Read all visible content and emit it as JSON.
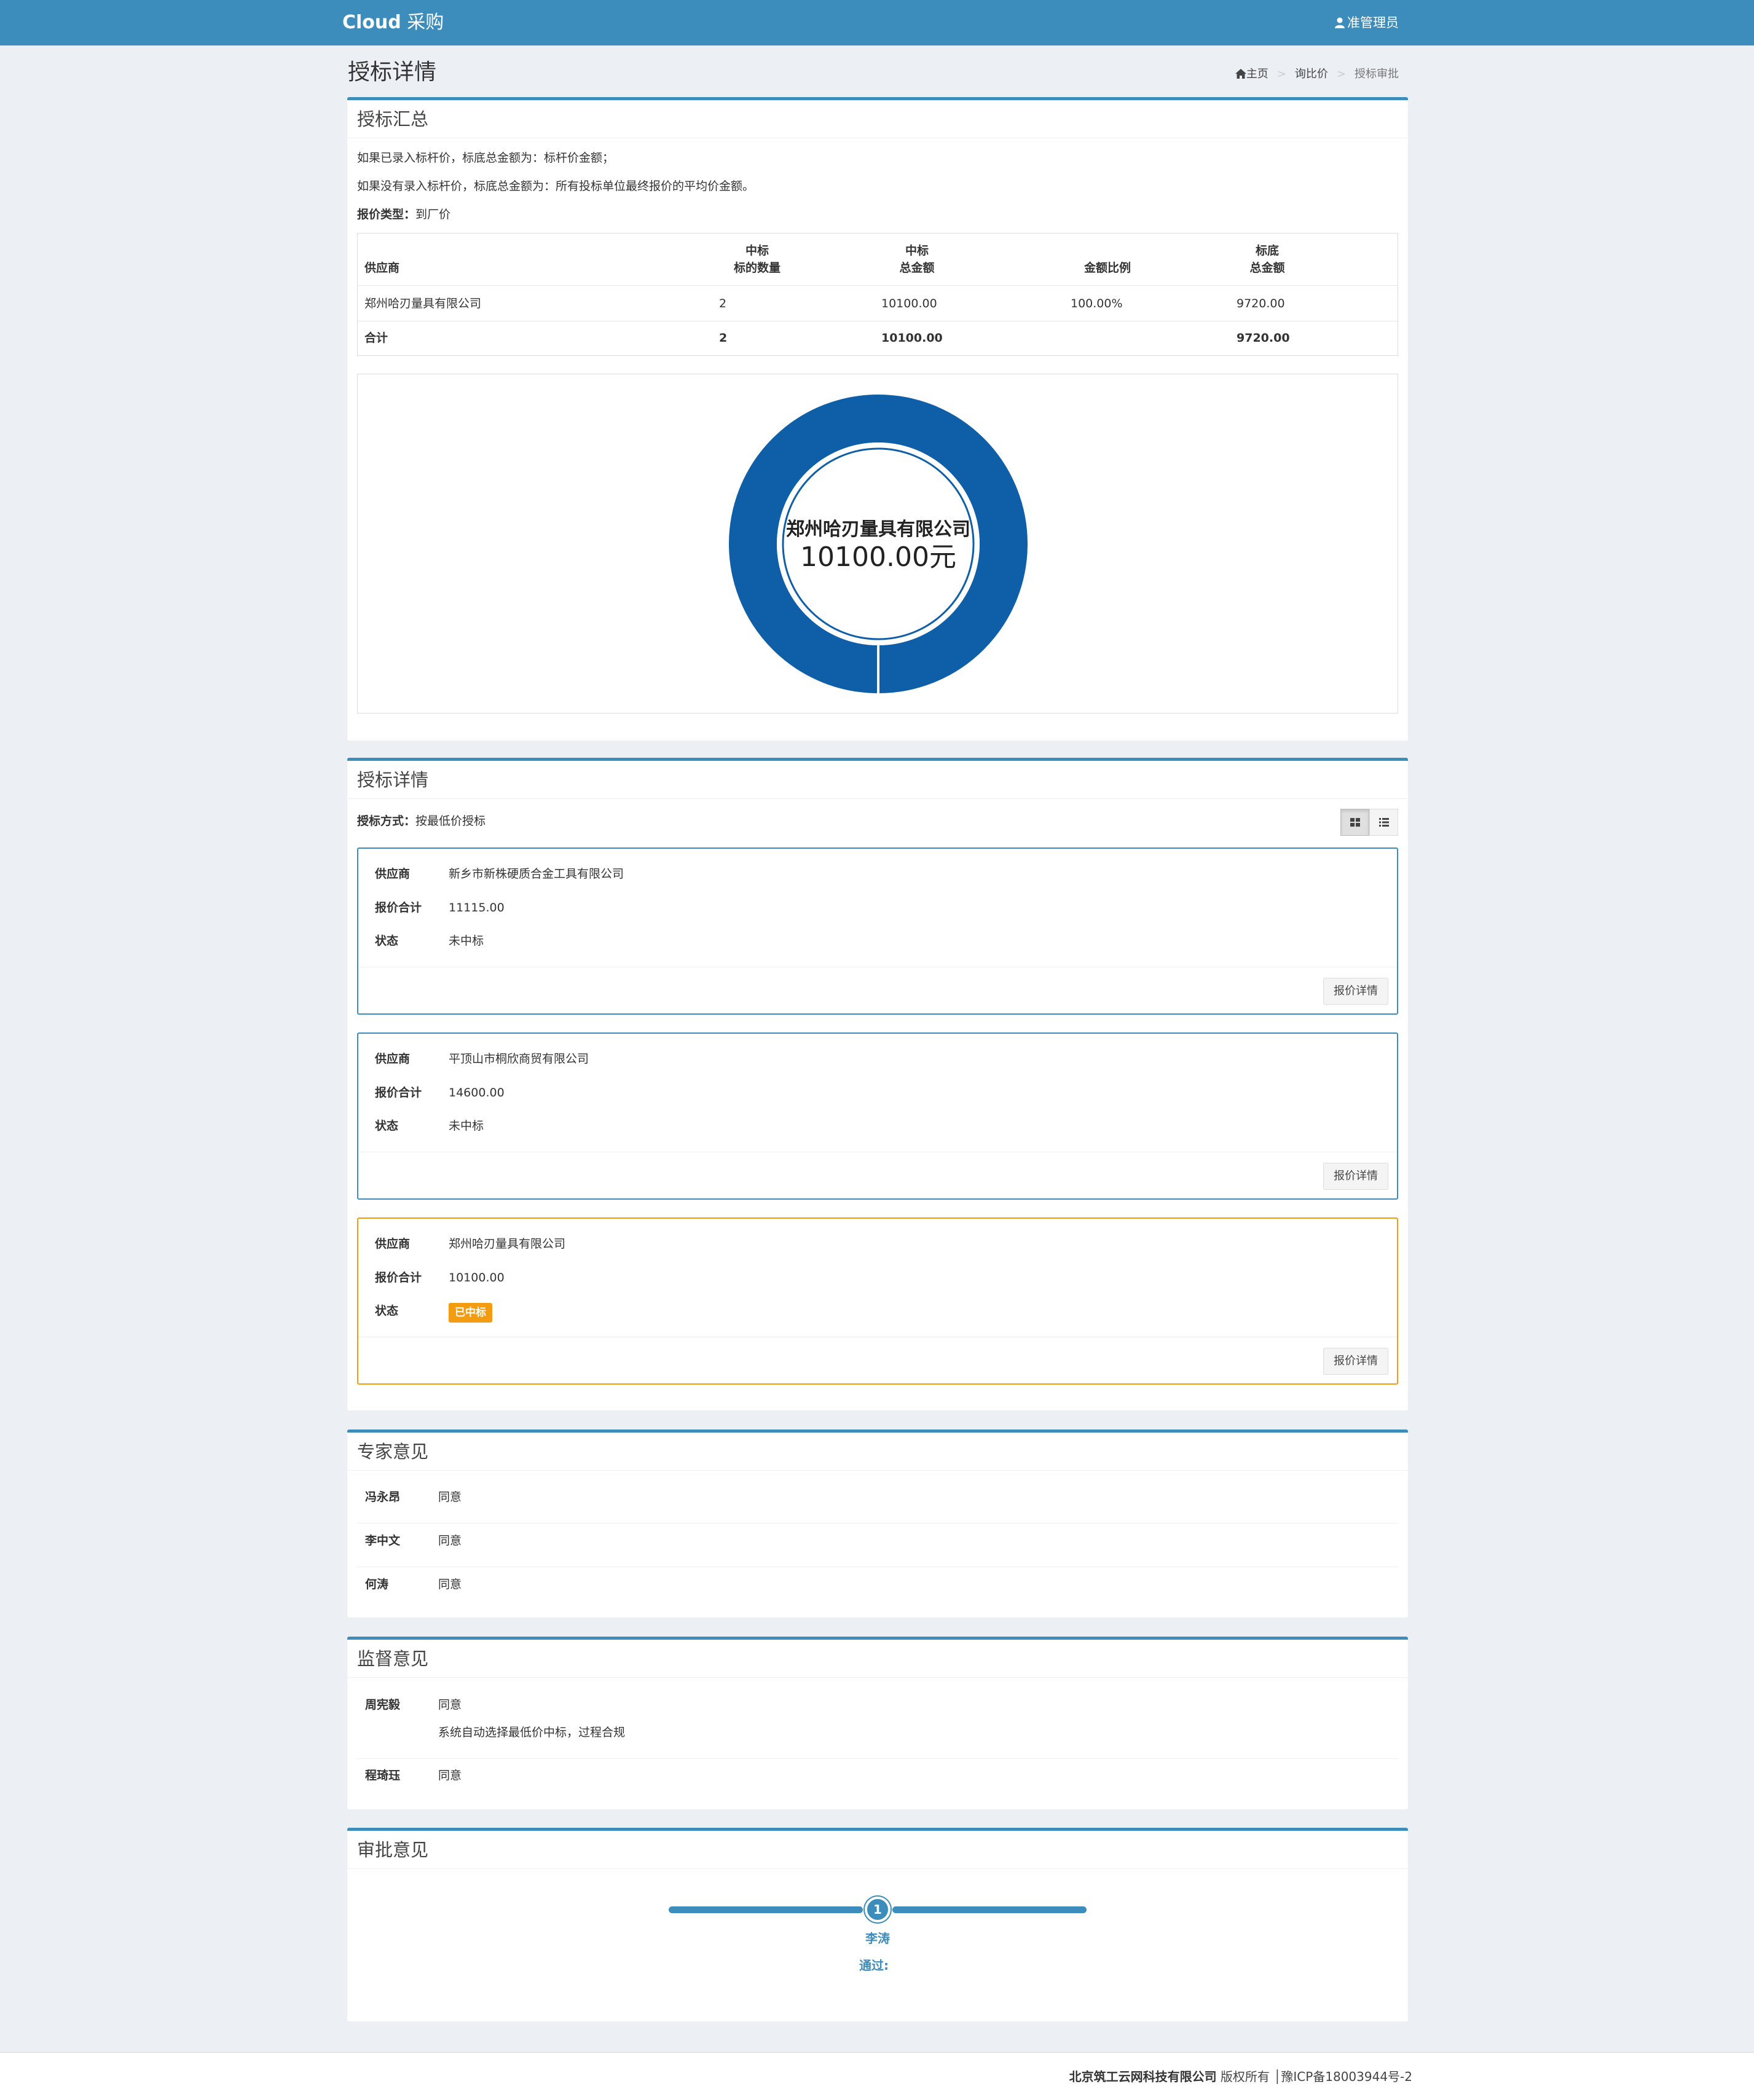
{
  "navbar": {
    "brand_bold": "Cloud",
    "brand_rest": " 采购",
    "user_icon": "user-icon",
    "user_label": "准管理员"
  },
  "header": {
    "title": "授标详情",
    "breadcrumb": [
      {
        "icon": "home-icon",
        "label": "主页"
      },
      {
        "label": "询比价"
      },
      {
        "label": "授标审批"
      }
    ]
  },
  "summary": {
    "title": "授标汇总",
    "note1": "如果已录入标杆价，标底总金额为：标杆价金额；",
    "note2": "如果没有录入标杆价，标底总金额为：所有投标单位最终报价的平均价金额。",
    "quote_type_label": "报价类型：",
    "quote_type_value": "到厂价",
    "table": {
      "headers": {
        "supplier": "供应商",
        "count_l1": "中标",
        "count_l2": "标的数量",
        "total_l1": "中标",
        "total_l2": "总金额",
        "ratio": "金额比例",
        "base_l1": "标底",
        "base_l2": "总金额"
      },
      "rows": [
        {
          "supplier": "郑州哈刃量具有限公司",
          "count": "2",
          "total": "10100.00",
          "ratio": "100.00%",
          "base": "9720.00"
        }
      ],
      "footer": {
        "supplier": "合计",
        "count": "2",
        "total": "10100.00",
        "ratio": "",
        "base": "9720.00"
      }
    }
  },
  "chart_data": {
    "type": "pie",
    "variant": "donut",
    "categories": [
      "郑州哈刃量具有限公司"
    ],
    "values": [
      10100.0
    ],
    "center_label": "郑州哈刃量具有限公司",
    "center_value": "10100.00元",
    "colors": [
      "#0e5ea8"
    ],
    "legend": "none"
  },
  "details": {
    "title": "授标详情",
    "method_label": "授标方式：",
    "method_value": "按最低价授标",
    "view_grid_icon": "grid-view-icon",
    "view_list_icon": "list-view-icon",
    "labels": {
      "supplier": "供应商",
      "total": "报价合计",
      "status": "状态"
    },
    "detail_button": "报价详情",
    "bids": [
      {
        "supplier": "新乡市新株硬质合金工具有限公司",
        "total": "11115.00",
        "status": "未中标",
        "won": false
      },
      {
        "supplier": "平顶山市桐欣商贸有限公司",
        "total": "14600.00",
        "status": "未中标",
        "won": false
      },
      {
        "supplier": "郑州哈刃量具有限公司",
        "total": "10100.00",
        "status": "已中标",
        "won": true
      }
    ]
  },
  "experts": {
    "title": "专家意见",
    "items": [
      {
        "name": "冯永昂",
        "opinion": "同意"
      },
      {
        "name": "李中文",
        "opinion": "同意"
      },
      {
        "name": "何涛",
        "opinion": "同意"
      }
    ]
  },
  "supervision": {
    "title": "监督意见",
    "items": [
      {
        "name": "周宪毅",
        "opinion": "同意",
        "extra": "系统自动选择最低价中标，过程合规"
      },
      {
        "name": "程琦珏",
        "opinion": "同意"
      }
    ]
  },
  "approval": {
    "title": "审批意见",
    "steps": [
      {
        "number": "1",
        "name": "李涛",
        "result": "通过:"
      }
    ]
  },
  "footer": {
    "company": "北京筑工云网科技有限公司",
    "rights": " 版权所有 │豫ICP备18003944号-2"
  }
}
